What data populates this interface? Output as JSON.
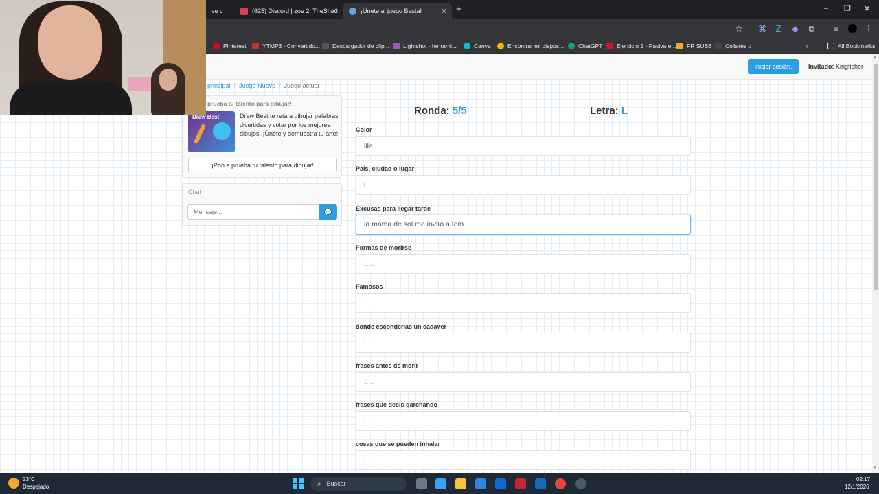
{
  "browser": {
    "tabs": [
      {
        "label": "ve c",
        "active": false
      },
      {
        "label": "(625) Discord | zoe 2, TheShad",
        "active": false
      },
      {
        "label": "¡Únete al juego Basta!",
        "active": true
      }
    ],
    "new_tab": "+",
    "window_controls": [
      "–",
      "❐",
      "✕"
    ],
    "bookmarks": [
      {
        "label": "Pinterest",
        "color": "#e60023"
      },
      {
        "label": "YTMP3 - Convertido...",
        "color": "#c4302b"
      },
      {
        "label": "Descargador de clip...",
        "color": "#555555"
      },
      {
        "label": "Lightshot - herrami...",
        "color": "#9b59b6"
      },
      {
        "label": "Canva",
        "color": "#00c4cc"
      },
      {
        "label": "Encontrar mi dispos...",
        "color": "#f4b400"
      },
      {
        "label": "ChatGPT",
        "color": "#10a37f"
      },
      {
        "label": "Ejercicio 1 - Pasiva e...",
        "color": "#cf142b"
      },
      {
        "label": "FR SUSB",
        "color": "#f5a623"
      },
      {
        "label": "Collares d",
        "color": "#444444"
      }
    ],
    "bookmarks_overflow": "»",
    "all_bookmarks": "All Bookmarks"
  },
  "navbar": {
    "login_label": "Iniciar sesión.",
    "guest_prefix": "Invitado:",
    "guest_name": "Kingfisher"
  },
  "breadcrumb": {
    "items": [
      "principal",
      "Juego Nuevo",
      "Juego actual"
    ],
    "separator": "/"
  },
  "promo": {
    "heading": "prueba tu talento para dibujar!",
    "image_caption": "Draw Best",
    "text": "Draw Best te reta a dibujar palabras divertidas y votar por los mejores dibujos. ¡Únete y demuestra tu arte!",
    "button_label": "¡Pon a prueba tu talento para dibujar!"
  },
  "chat": {
    "heading": "Chat",
    "placeholder": "Mensaje...",
    "send_icon": "chat-bubble-icon"
  },
  "game": {
    "round_label": "Ronda:",
    "round_value": "5/5",
    "letter_label": "Letra:",
    "letter_value": "L",
    "accent_color": "#2d9ee0",
    "fields": [
      {
        "label": "Color",
        "value": "lila",
        "placeholder": "L..."
      },
      {
        "label": "Pais, ciudad o lugar",
        "value": "l",
        "placeholder": "L..."
      },
      {
        "label": "Excusas para llegar tarde",
        "value": "la mama de sol me invito a tom",
        "placeholder": "L...",
        "focused": true
      },
      {
        "label": "Formas de morirse",
        "value": "",
        "placeholder": "L..."
      },
      {
        "label": "Famosos",
        "value": "",
        "placeholder": "L..."
      },
      {
        "label": "donde esconderias un cadaver",
        "value": "",
        "placeholder": "L..."
      },
      {
        "label": "frases antes de morir",
        "value": "",
        "placeholder": "L..."
      },
      {
        "label": "frases que decis garchando",
        "value": "",
        "placeholder": "L..."
      },
      {
        "label": "cosas que se pueden inhalar",
        "value": "",
        "placeholder": "L..."
      }
    ]
  },
  "taskbar": {
    "weather_temp": "23°C",
    "weather_desc": "Despejado",
    "search_label": "Buscar",
    "time": "02:17",
    "date": "12/1/2026"
  }
}
